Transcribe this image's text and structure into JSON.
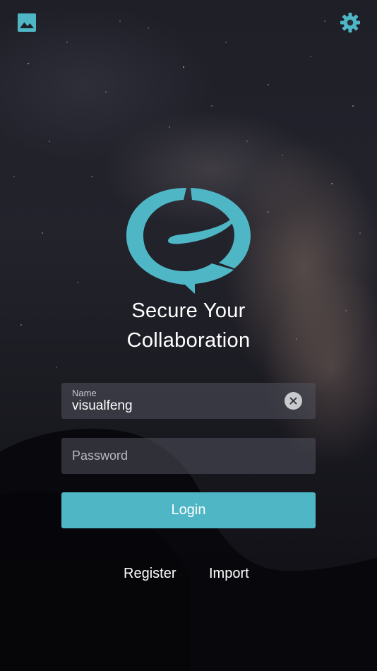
{
  "toolbar": {
    "left_icon": "image-icon",
    "right_icon": "gear-icon"
  },
  "colors": {
    "accent": "#4FB6C6",
    "field_bg": "#50525C",
    "clear_button": "#C9CACD"
  },
  "branding": {
    "logo_icon": "speech-bubble-logo",
    "tagline_line1": "Secure Your",
    "tagline_line2": "Collaboration"
  },
  "form": {
    "name_label": "Name",
    "name_value": "visualfeng",
    "clear_icon": "close-icon",
    "password_placeholder": "Password",
    "login_label": "Login"
  },
  "links": {
    "register": "Register",
    "import": "Import"
  }
}
